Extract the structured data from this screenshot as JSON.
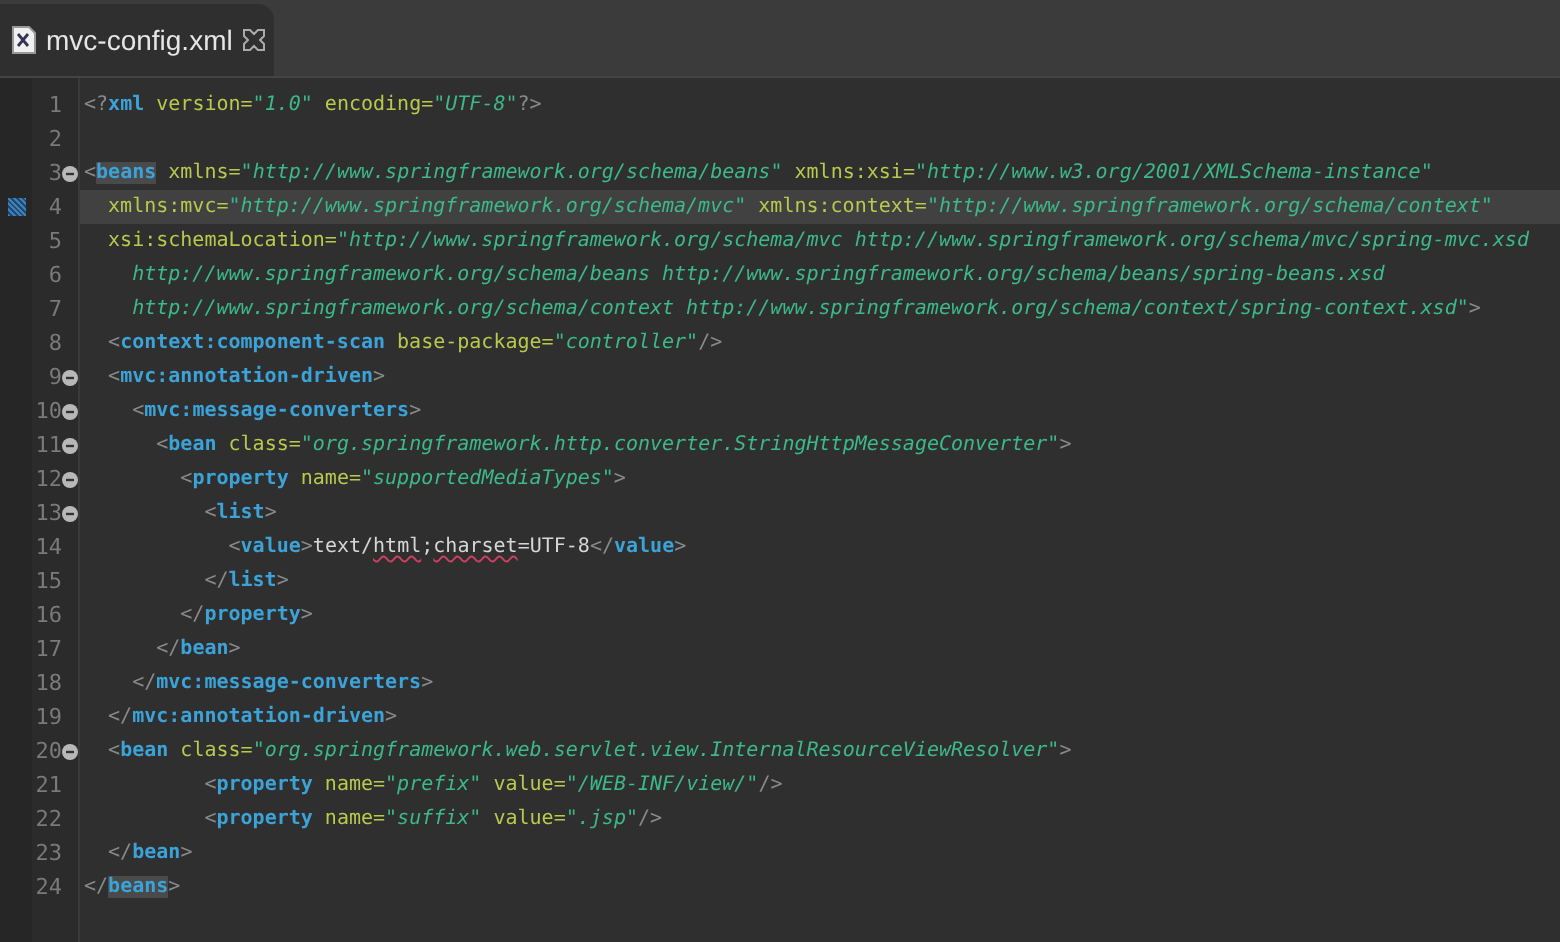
{
  "tab": {
    "title": "mvc-config.xml",
    "selected": true
  },
  "lines": [
    {
      "number": "1",
      "foldable": false,
      "current": false,
      "tokens": [
        {
          "kind": "punct",
          "text": "<?"
        },
        {
          "kind": "tag",
          "text": "xml"
        },
        {
          "kind": "attr",
          "text": " version="
        },
        {
          "kind": "value",
          "text": "\"1.0\""
        },
        {
          "kind": "attr",
          "text": " encoding="
        },
        {
          "kind": "value",
          "text": "\"UTF-8\""
        },
        {
          "kind": "punct",
          "text": "?>"
        }
      ]
    },
    {
      "number": "2",
      "foldable": false,
      "current": false
    },
    {
      "number": "3",
      "foldable": true,
      "current": false,
      "tokens": [
        {
          "kind": "punct",
          "text": "<"
        },
        {
          "kind": "tag_match",
          "text": "beans"
        },
        {
          "kind": "attr",
          "text": " xmlns="
        },
        {
          "kind": "value",
          "text": "\"http://www.springframework.org/schema/beans\""
        },
        {
          "kind": "attr",
          "text": " xmlns:xsi="
        },
        {
          "kind": "value",
          "text": "\"http://www.w3.org/2001/XMLSchema-instance\""
        }
      ]
    },
    {
      "number": "4",
      "foldable": false,
      "current": true,
      "tokens": [
        {
          "kind": "attr",
          "text": "  xmlns:mvc="
        },
        {
          "kind": "value",
          "text": "\"http://www.springframework.org/schema/mvc\""
        },
        {
          "kind": "attr",
          "text": " xmlns:context="
        },
        {
          "kind": "value",
          "text": "\"http://www.springframework.org/schema/context\""
        }
      ]
    },
    {
      "number": "5",
      "foldable": false,
      "current": false,
      "tokens": [
        {
          "kind": "attr",
          "text": "  xsi:schemaLocation="
        },
        {
          "kind": "value",
          "text": "\"http://www.springframework.org/schema/mvc http://www.springframework.org/schema/mvc/spring-mvc.xsd"
        }
      ]
    },
    {
      "number": "6",
      "foldable": false,
      "current": false,
      "tokens": [
        {
          "kind": "value",
          "text": "    http://www.springframework.org/schema/beans http://www.springframework.org/schema/beans/spring-beans.xsd"
        }
      ]
    },
    {
      "number": "7",
      "foldable": false,
      "current": false,
      "tokens": [
        {
          "kind": "value",
          "text": "    http://www.springframework.org/schema/context http://www.springframework.org/schema/context/spring-context.xsd\""
        },
        {
          "kind": "punct",
          "text": ">"
        }
      ]
    },
    {
      "number": "8",
      "foldable": false,
      "current": false,
      "tokens": [
        {
          "kind": "punct",
          "text": "  <"
        },
        {
          "kind": "tag",
          "text": "context:component-scan"
        },
        {
          "kind": "attr",
          "text": " base-package="
        },
        {
          "kind": "value",
          "text": "\"controller\""
        },
        {
          "kind": "punct",
          "text": "/>"
        }
      ]
    },
    {
      "number": "9",
      "foldable": true,
      "current": false,
      "tokens": [
        {
          "kind": "punct",
          "text": "  <"
        },
        {
          "kind": "tag",
          "text": "mvc:annotation-driven"
        },
        {
          "kind": "punct",
          "text": ">"
        }
      ]
    },
    {
      "number": "10",
      "foldable": true,
      "current": false,
      "tokens": [
        {
          "kind": "punct",
          "text": "    <"
        },
        {
          "kind": "tag",
          "text": "mvc:message-converters"
        },
        {
          "kind": "punct",
          "text": ">"
        }
      ]
    },
    {
      "number": "11",
      "foldable": true,
      "current": false,
      "tokens": [
        {
          "kind": "punct",
          "text": "      <"
        },
        {
          "kind": "tag",
          "text": "bean"
        },
        {
          "kind": "attr",
          "text": " class="
        },
        {
          "kind": "value",
          "text": "\"org.springframework.http.converter.StringHttpMessageConverter\""
        },
        {
          "kind": "punct",
          "text": ">"
        }
      ]
    },
    {
      "number": "12",
      "foldable": true,
      "current": false,
      "tokens": [
        {
          "kind": "punct",
          "text": "        <"
        },
        {
          "kind": "tag",
          "text": "property"
        },
        {
          "kind": "attr",
          "text": " name="
        },
        {
          "kind": "value",
          "text": "\"supportedMediaTypes\""
        },
        {
          "kind": "punct",
          "text": ">"
        }
      ]
    },
    {
      "number": "13",
      "foldable": true,
      "current": false,
      "tokens": [
        {
          "kind": "punct",
          "text": "          <"
        },
        {
          "kind": "tag",
          "text": "list"
        },
        {
          "kind": "punct",
          "text": ">"
        }
      ]
    },
    {
      "number": "14",
      "foldable": false,
      "current": false,
      "tokens": [
        {
          "kind": "punct",
          "text": "            <"
        },
        {
          "kind": "tag",
          "text": "value"
        },
        {
          "kind": "punct",
          "text": ">"
        },
        {
          "kind": "text",
          "text": "text/"
        },
        {
          "kind": "misspelled",
          "text": "html"
        },
        {
          "kind": "text",
          "text": ";"
        },
        {
          "kind": "misspelled",
          "text": "charset"
        },
        {
          "kind": "text",
          "text": "=UTF-8"
        },
        {
          "kind": "punct",
          "text": "</"
        },
        {
          "kind": "tag",
          "text": "value"
        },
        {
          "kind": "punct",
          "text": ">"
        }
      ]
    },
    {
      "number": "15",
      "foldable": false,
      "current": false,
      "tokens": [
        {
          "kind": "punct",
          "text": "          </"
        },
        {
          "kind": "tag",
          "text": "list"
        },
        {
          "kind": "punct",
          "text": ">"
        }
      ]
    },
    {
      "number": "16",
      "foldable": false,
      "current": false,
      "tokens": [
        {
          "kind": "punct",
          "text": "        </"
        },
        {
          "kind": "tag",
          "text": "property"
        },
        {
          "kind": "punct",
          "text": ">"
        }
      ]
    },
    {
      "number": "17",
      "foldable": false,
      "current": false,
      "tokens": [
        {
          "kind": "punct",
          "text": "      </"
        },
        {
          "kind": "tag",
          "text": "bean"
        },
        {
          "kind": "punct",
          "text": ">"
        }
      ]
    },
    {
      "number": "18",
      "foldable": false,
      "current": false,
      "tokens": [
        {
          "kind": "punct",
          "text": "    </"
        },
        {
          "kind": "tag",
          "text": "mvc:message-converters"
        },
        {
          "kind": "punct",
          "text": ">"
        }
      ]
    },
    {
      "number": "19",
      "foldable": false,
      "current": false,
      "tokens": [
        {
          "kind": "punct",
          "text": "  </"
        },
        {
          "kind": "tag",
          "text": "mvc:annotation-driven"
        },
        {
          "kind": "punct",
          "text": ">"
        }
      ]
    },
    {
      "number": "20",
      "foldable": true,
      "current": false,
      "tokens": [
        {
          "kind": "punct",
          "text": "  <"
        },
        {
          "kind": "tag",
          "text": "bean"
        },
        {
          "kind": "attr",
          "text": " class="
        },
        {
          "kind": "value",
          "text": "\"org.springframework.web.servlet.view.InternalResourceViewResolver\""
        },
        {
          "kind": "punct",
          "text": ">"
        }
      ]
    },
    {
      "number": "21",
      "foldable": false,
      "current": false,
      "tokens": [
        {
          "kind": "punct",
          "text": "          <"
        },
        {
          "kind": "tag",
          "text": "property"
        },
        {
          "kind": "attr",
          "text": " name="
        },
        {
          "kind": "value",
          "text": "\"prefix\""
        },
        {
          "kind": "attr",
          "text": " value="
        },
        {
          "kind": "value",
          "text": "\"/WEB-INF/view/\""
        },
        {
          "kind": "punct",
          "text": "/>"
        }
      ]
    },
    {
      "number": "22",
      "foldable": false,
      "current": false,
      "tokens": [
        {
          "kind": "punct",
          "text": "          <"
        },
        {
          "kind": "tag",
          "text": "property"
        },
        {
          "kind": "attr",
          "text": " name="
        },
        {
          "kind": "value",
          "text": "\"suffix\""
        },
        {
          "kind": "attr",
          "text": " value="
        },
        {
          "kind": "value",
          "text": "\".jsp\""
        },
        {
          "kind": "punct",
          "text": "/>"
        }
      ]
    },
    {
      "number": "23",
      "foldable": false,
      "current": false,
      "tokens": [
        {
          "kind": "punct",
          "text": "  </"
        },
        {
          "kind": "tag",
          "text": "bean"
        },
        {
          "kind": "punct",
          "text": ">"
        }
      ]
    },
    {
      "number": "24",
      "foldable": false,
      "current": false,
      "tokens": [
        {
          "kind": "punct",
          "text": "</"
        },
        {
          "kind": "tag_match",
          "text": "beans"
        },
        {
          "kind": "punct",
          "text": ">"
        }
      ]
    }
  ]
}
